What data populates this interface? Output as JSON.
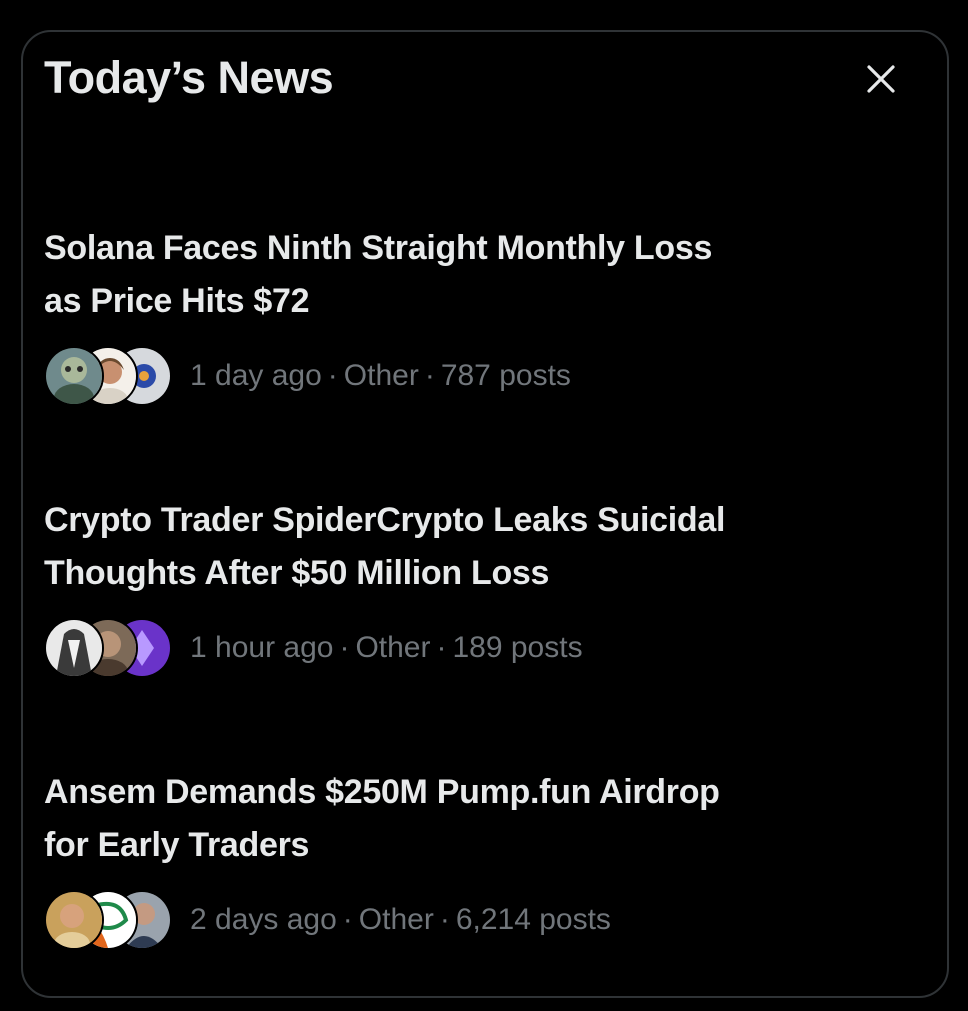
{
  "panel": {
    "title": "Today’s News",
    "close_icon": "close-icon"
  },
  "news": [
    {
      "headline_line1": "Solana Faces Ninth Straight Monthly Loss",
      "headline_line2": "as Price Hits $72",
      "time": "1 day ago",
      "category": "Other",
      "posts": "787 posts",
      "avatars": [
        "avatar-1",
        "avatar-2",
        "avatar-3"
      ]
    },
    {
      "headline_line1": "Crypto Trader SpiderCrypto Leaks Suicidal",
      "headline_line2": "Thoughts After $50 Million Loss",
      "time": "1 hour ago",
      "category": "Other",
      "posts": "189 posts",
      "avatars": [
        "avatar-1",
        "avatar-2",
        "avatar-3"
      ]
    },
    {
      "headline_line1": "Ansem Demands $250M Pump.fun Airdrop",
      "headline_line2": "for Early Traders",
      "time": "2 days ago",
      "category": "Other",
      "posts": "6,214 posts",
      "avatars": [
        "avatar-1",
        "avatar-2",
        "avatar-3"
      ]
    }
  ],
  "separator": "·",
  "colors": {
    "background": "#000000",
    "border": "#2f3336",
    "text_primary": "#e7e9ea",
    "text_secondary": "#71767b"
  }
}
